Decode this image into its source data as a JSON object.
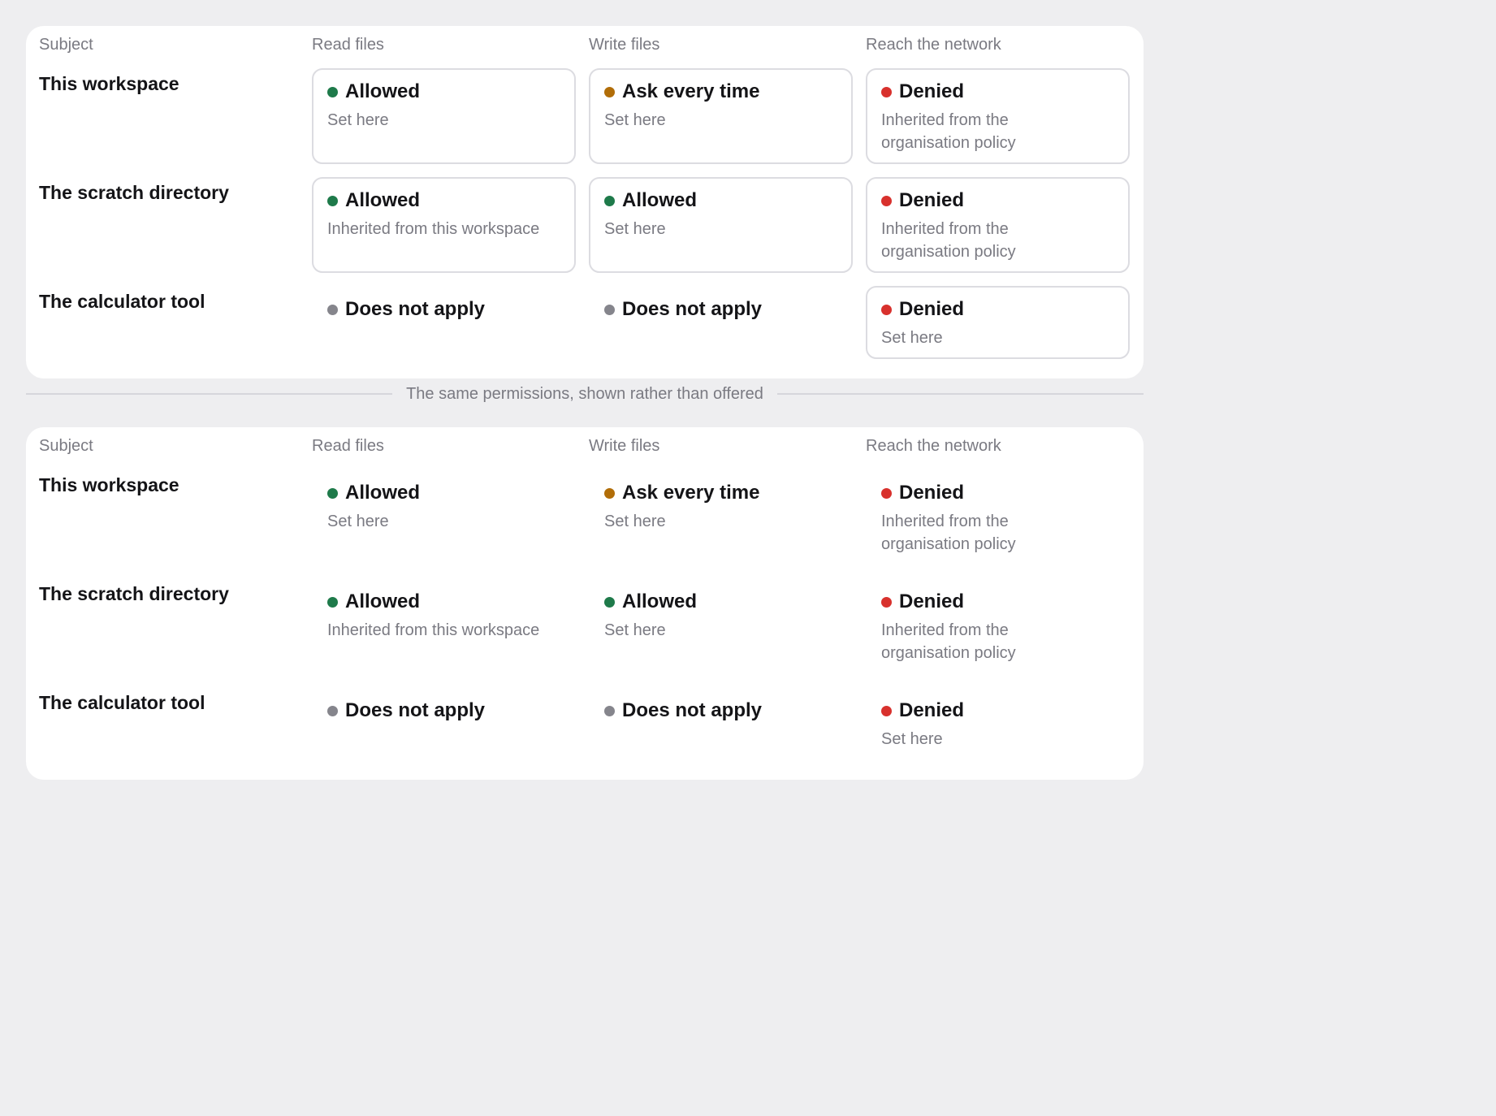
{
  "columns": {
    "subject": "Subject",
    "read": "Read files",
    "write": "Write files",
    "network": "Reach the network"
  },
  "divider_caption": "The same permissions, shown rather than offered",
  "rows": [
    {
      "subject": "This workspace",
      "read": {
        "status": "Allowed",
        "source": "Set here"
      },
      "write": {
        "status": "Ask every time",
        "source": "Set here"
      },
      "network": {
        "status": "Denied",
        "source": "Inherited from the organisation policy"
      }
    },
    {
      "subject": "The scratch directory",
      "read": {
        "status": "Allowed",
        "source": "Inherited from this workspace"
      },
      "write": {
        "status": "Allowed",
        "source": "Set here"
      },
      "network": {
        "status": "Denied",
        "source": "Inherited from the organisation policy"
      }
    },
    {
      "subject": "The calculator tool",
      "read": {
        "status": "Does not apply"
      },
      "write": {
        "status": "Does not apply"
      },
      "network": {
        "status": "Denied",
        "source": "Set here"
      }
    }
  ],
  "colors": {
    "allowed": "#1e7a4a",
    "ask": "#b16d08",
    "denied": "#d8312d",
    "not_applicable": "#85858c"
  },
  "icons": {
    "status": "status-dot-icon"
  }
}
